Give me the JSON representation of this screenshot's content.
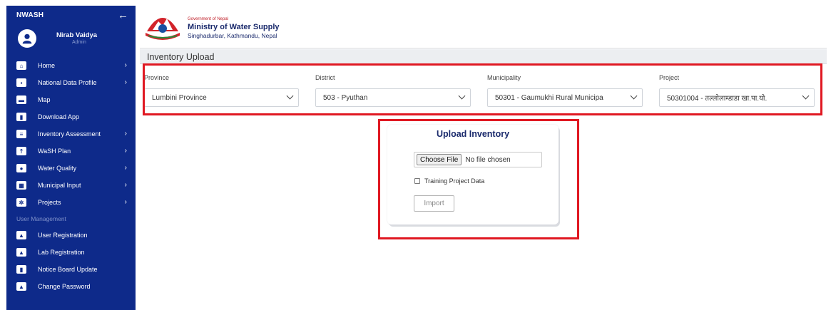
{
  "sidebar": {
    "brand": "NWASH",
    "back_icon": "arrow-left-icon",
    "user": {
      "name": "Nirab Vaidya",
      "role": "Admin"
    },
    "menu": [
      {
        "label": "Home",
        "icon": "home-icon",
        "glyph": "⌂",
        "arrow": "›"
      },
      {
        "label": "National Data Profile",
        "icon": "database-icon",
        "glyph": "▪",
        "arrow": "›"
      },
      {
        "label": "Map",
        "icon": "map-icon",
        "glyph": "▬",
        "arrow": ""
      },
      {
        "label": "Download App",
        "icon": "mobile-icon",
        "glyph": "▮",
        "arrow": ""
      },
      {
        "label": "Inventory Assessment",
        "icon": "list-icon",
        "glyph": "≡",
        "arrow": "›"
      },
      {
        "label": "WaSH Plan",
        "icon": "upload-icon",
        "glyph": "⇡",
        "arrow": "›"
      },
      {
        "label": "Water Quality",
        "icon": "droplet-icon",
        "glyph": "●",
        "arrow": "›"
      },
      {
        "label": "Municipal Input",
        "icon": "building-icon",
        "glyph": "▦",
        "arrow": "›"
      },
      {
        "label": "Projects",
        "icon": "cogs-icon",
        "glyph": "✲",
        "arrow": "›"
      }
    ],
    "section_label": "User Management",
    "user_menu": [
      {
        "label": "User Registration",
        "icon": "user-icon",
        "glyph": "▲"
      },
      {
        "label": "Lab Registration",
        "icon": "flask-icon",
        "glyph": "▲"
      },
      {
        "label": "Notice Board Update",
        "icon": "notice-icon",
        "glyph": "▮"
      },
      {
        "label": "Change Password",
        "icon": "lock-icon",
        "glyph": "▲"
      }
    ]
  },
  "header": {
    "government": "Government of Nepal",
    "ministry": "Ministry of Water Supply",
    "address": "Singhadurbar, Kathmandu, Nepal"
  },
  "page": {
    "title": "Inventory Upload"
  },
  "filters": {
    "province": {
      "label": "Province",
      "value": "Lumbini Province"
    },
    "district": {
      "label": "District",
      "value": "503 - Pyuthan"
    },
    "municipality": {
      "label": "Municipality",
      "value": "50301 - Gaumukhi Rural Municipa"
    },
    "project": {
      "label": "Project",
      "value": "50301004 - तल्लोलाम्डाडा खा.पा.यो."
    }
  },
  "upload": {
    "title": "Upload Inventory",
    "choose_file": "Choose File",
    "file_status": "No file chosen",
    "training_label": "Training Project Data",
    "training_checked": false,
    "import_label": "Import"
  },
  "colors": {
    "sidebar_bg": "#0e2a8a",
    "highlight": "#e01822",
    "title_blue": "#1a2a6c"
  }
}
